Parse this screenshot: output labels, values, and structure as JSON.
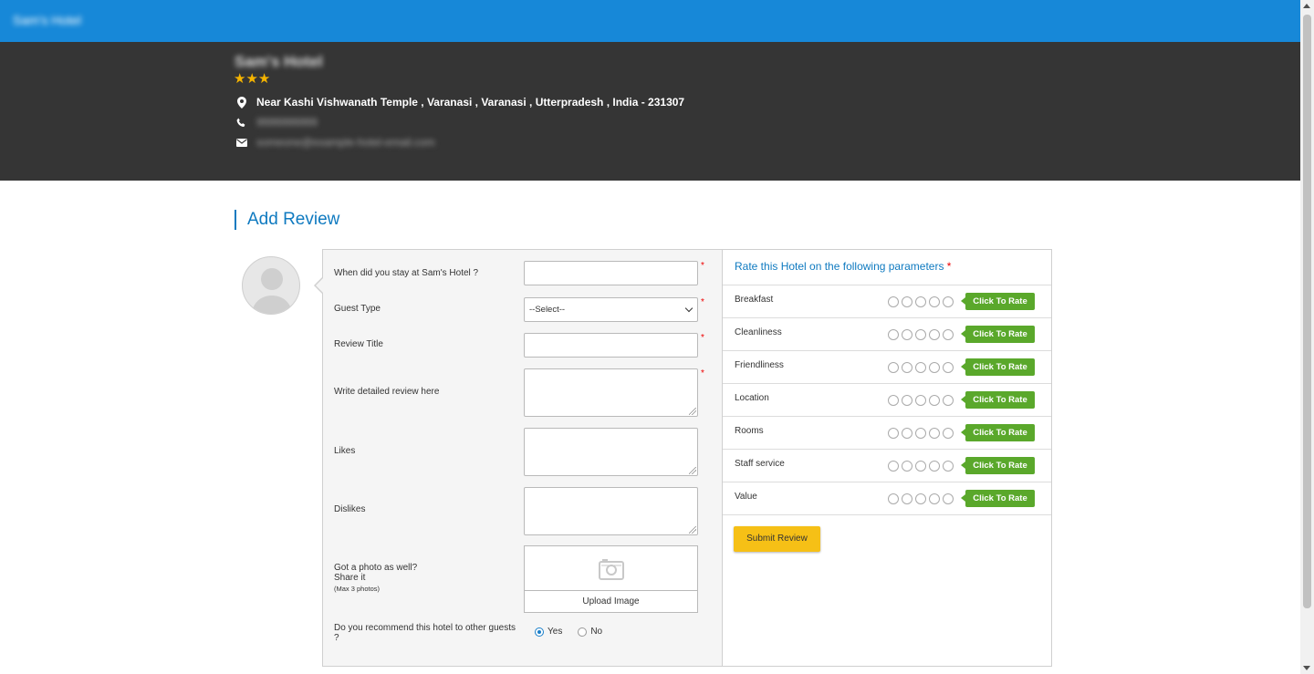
{
  "topbar": {
    "brand": "Sam's Hotel"
  },
  "hotel": {
    "name": "Sam's Hotel",
    "stars": "★★★",
    "address": "Near Kashi Vishwanath Temple , Varanasi , Varanasi , Utterpradesh , India - 231307",
    "phone": "9999999999",
    "email": "someone@example-hotel-email.com"
  },
  "section": {
    "title": "Add Review"
  },
  "form": {
    "stay_label": "When did you stay at Sam's Hotel ?",
    "guest_type_label": "Guest Type",
    "guest_type_value": "--Select--",
    "review_title_label": "Review Title",
    "detailed_label": "Write detailed review here",
    "likes_label": "Likes",
    "dislikes_label": "Dislikes",
    "photo_label_1": "Got a photo as well?",
    "photo_label_2": "Share it",
    "photo_label_small": "(Max 3 photos)",
    "upload_label": "Upload Image",
    "recommend_label": "Do you recommend this hotel to other guests ?",
    "yes_label": "Yes",
    "no_label": "No",
    "required_mark": "*"
  },
  "rating": {
    "header": "Rate this Hotel on the following parameters",
    "required_mark": "*",
    "button_label": "Click To Rate",
    "params": [
      "Breakfast",
      "Cleanliness",
      "Friendliness",
      "Location",
      "Rooms",
      "Staff service",
      "Value"
    ],
    "submit_label": "Submit Review"
  },
  "colors": {
    "topbar": "#1788d8",
    "hotelbar": "#353535",
    "accent": "#0f7ac0",
    "rate_button": "#5aa82b",
    "submit_button": "#f6c016",
    "stars": "#f5b400"
  }
}
